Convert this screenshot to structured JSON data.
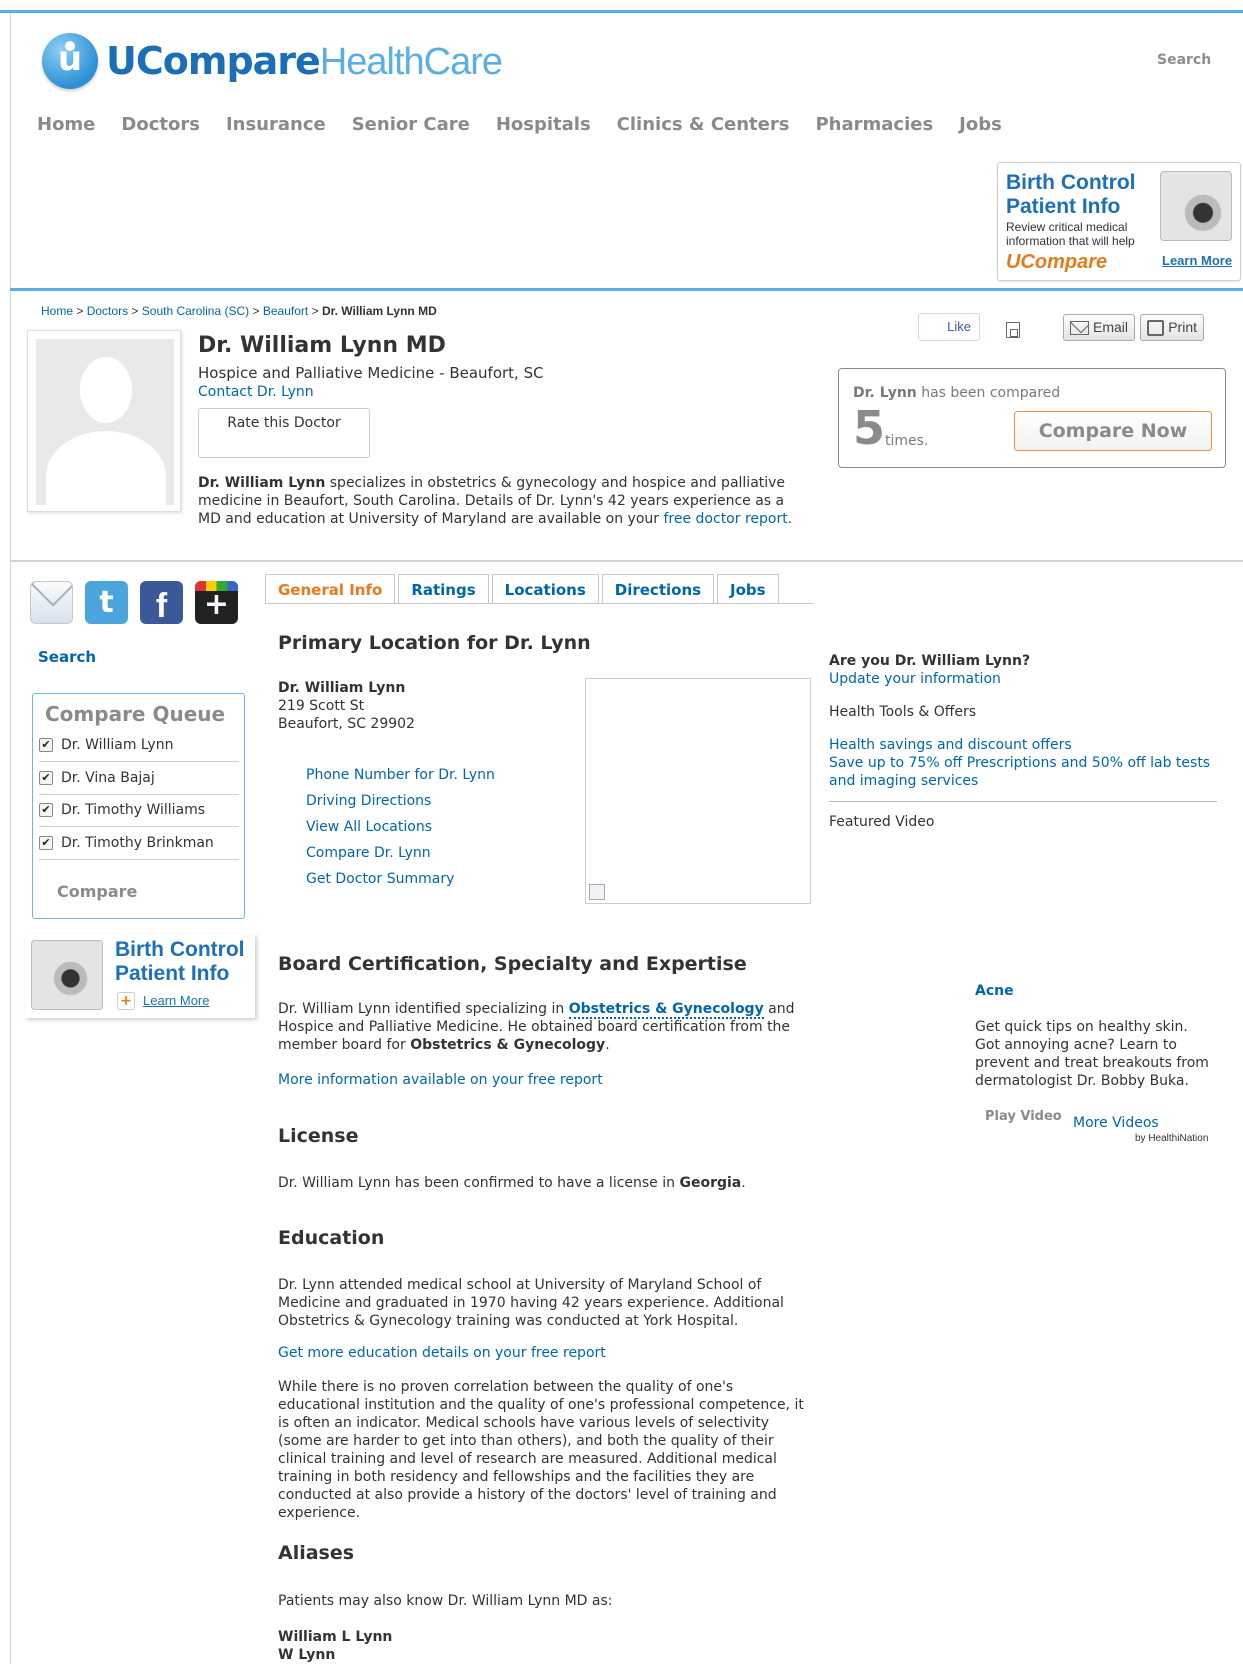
{
  "header": {
    "logo_primary": "UCompare",
    "logo_secondary": "HealthCare",
    "search_label": "Search"
  },
  "nav": [
    "Home",
    "Doctors",
    "Insurance",
    "Senior Care",
    "Hospitals",
    "Clinics & Centers",
    "Pharmacies",
    "Jobs"
  ],
  "ad_top": {
    "title_line1": "Birth Control",
    "title_line2": "Patient Info",
    "subtitle": "Review critical medical information that will help",
    "brand": "UCompare",
    "learn_more": "Learn More"
  },
  "breadcrumb": {
    "items": [
      "Home",
      "Doctors",
      "South Carolina (SC)",
      "Beaufort"
    ],
    "separator": ">",
    "current": "Dr. William Lynn MD"
  },
  "actions": {
    "like": "Like",
    "email": "Email",
    "print": "Print"
  },
  "profile": {
    "name": "Dr. William Lynn MD",
    "specialty_location": "Hospice and Palliative Medicine - Beaufort, SC",
    "contact": "Contact Dr. Lynn",
    "rate": "Rate this Doctor",
    "desc_name": "Dr. William Lynn",
    "desc_text": " specializes in obstetrics & gynecology and hospice and palliative medicine in Beaufort, South Carolina. Details of Dr. Lynn's 42 years experience as a MD and education at University of Maryland are available on your ",
    "desc_link": "free doctor report",
    "desc_end": "."
  },
  "compared": {
    "name": "Dr. Lynn",
    "text": " has been compared",
    "count": "5",
    "times": "times.",
    "button": "Compare Now"
  },
  "sidebar": {
    "search": "Search",
    "queue_title": "Compare Queue",
    "queue": [
      "Dr. William Lynn",
      "Dr. Vina Bajaj",
      "Dr. Timothy Williams",
      "Dr. Timothy Brinkman"
    ],
    "compare": "Compare",
    "ad_title_line1": "Birth Control",
    "ad_title_line2": "Patient Info",
    "ad_learn": "Learn More"
  },
  "tabs": [
    "General Info",
    "Ratings",
    "Locations",
    "Directions",
    "Jobs"
  ],
  "primary": {
    "heading": "Primary Location for Dr. Lynn",
    "name": "Dr. William Lynn",
    "street": "219 Scott St",
    "city": "Beaufort, SC 29902",
    "links": [
      "Phone Number for Dr. Lynn",
      "Driving Directions",
      "View All Locations",
      "Compare Dr. Lynn",
      "Get Doctor Summary"
    ]
  },
  "board": {
    "heading": "Board Certification, Specialty and Expertise",
    "text1": "Dr. William Lynn identified specializing in ",
    "specialty_link": "Obstetrics & Gynecology",
    "text2": " and Hospice and Palliative Medicine. He obtained board certification from the member board for ",
    "board_name": "Obstetrics & Gynecology",
    "text3": ".",
    "more": "More information available on your free report"
  },
  "license": {
    "heading": "License",
    "text": "Dr. William Lynn has been confirmed to have a license in ",
    "state": "Georgia",
    "end": "."
  },
  "education": {
    "heading": "Education",
    "text": "Dr. Lynn attended medical school at University of Maryland School of Medicine and graduated in 1970 having 42 years experience. Additional Obstetrics & Gynecology training was conducted at York Hospital.",
    "link": "Get more education details on your free report",
    "disclaimer": "While there is no proven correlation between the quality of one's educational institution and the quality of one's professional competence, it is often an indicator. Medical schools have various levels of selectivity (some are harder to get into than others), and both the quality of their clinical training and level of research are measured. Additional medical training in both residency and fellowships and the facilities they are conducted at also provide a history of the doctors' level of training and experience."
  },
  "aliases": {
    "heading": "Aliases",
    "intro": "Patients may also know Dr. William Lynn MD as:",
    "names": [
      "William L Lynn",
      "W Lynn"
    ]
  },
  "right": {
    "are_you": "Are you Dr. William Lynn?",
    "update": "Update your information",
    "tools": "Health Tools & Offers",
    "savings": "Health savings and discount offers",
    "save_up": "Save up to 75% off Prescriptions and 50% off lab tests and imaging services",
    "featured": "Featured Video",
    "video_title": "Acne",
    "video_text": "Get quick tips on healthy skin. Got annoying acne? Learn to prevent and treat breakouts from dermatologist Dr. Bobby Buka.",
    "play": "Play Video",
    "more_videos": "More Videos",
    "by": "by HealthiNation"
  }
}
